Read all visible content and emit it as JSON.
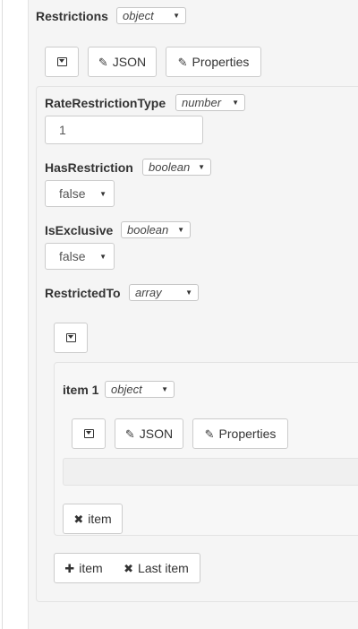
{
  "restrictions": {
    "label": "Restrictions",
    "type": "object",
    "buttons": {
      "json_label": "JSON",
      "properties_label": "Properties"
    }
  },
  "fields": {
    "rate_restriction_type": {
      "label": "RateRestrictionType",
      "type": "number",
      "value": "1"
    },
    "has_restriction": {
      "label": "HasRestriction",
      "type": "boolean",
      "value": "false"
    },
    "is_exclusive": {
      "label": "IsExclusive",
      "type": "boolean",
      "value": "false"
    },
    "restricted_to": {
      "label": "RestrictedTo",
      "type": "array"
    }
  },
  "item1": {
    "label": "item 1",
    "type": "object",
    "buttons": {
      "json_label": "JSON",
      "properties_label": "Properties",
      "delete_label": "item"
    }
  },
  "array_buttons": {
    "add_label": "item",
    "delete_last_label": "Last item"
  },
  "icons": {
    "collapse": "collapse-icon",
    "pencil": "pencil-icon",
    "plus": "plus-icon",
    "remove": "remove-icon",
    "caret": "caret-down-icon"
  },
  "colors": {
    "background": "#f5f5f5",
    "border": "#cccccc",
    "text": "#333333"
  }
}
